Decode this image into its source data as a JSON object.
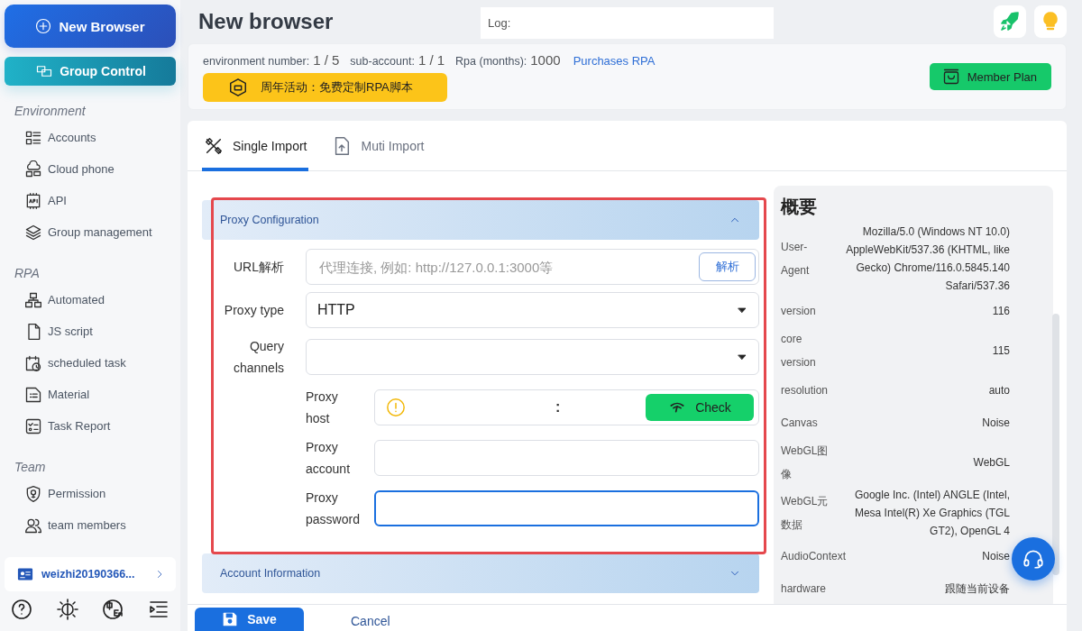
{
  "sidebar": {
    "new_button": "New Browser",
    "group_button": "Group Control",
    "sections": [
      {
        "title": "Environment",
        "items": [
          {
            "label": "Accounts"
          },
          {
            "label": "Cloud phone"
          },
          {
            "label": "API"
          },
          {
            "label": "Group management"
          }
        ]
      },
      {
        "title": "RPA",
        "items": [
          {
            "label": "Automated"
          },
          {
            "label": "JS script"
          },
          {
            "label": "scheduled task"
          },
          {
            "label": "Material"
          },
          {
            "label": "Task Report"
          }
        ]
      },
      {
        "title": "Team",
        "items": [
          {
            "label": "Permission"
          },
          {
            "label": "team members"
          }
        ]
      }
    ],
    "user": "weizhi20190366..."
  },
  "header": {
    "title": "New browser",
    "log_placeholder": "Log:"
  },
  "info": {
    "stats": [
      {
        "label": "environment number:",
        "value": "1 / 5"
      },
      {
        "label": "sub-account:",
        "value": "1 / 1"
      },
      {
        "label": "Rpa (months):",
        "value": "1000"
      }
    ],
    "link": "Purchases RPA",
    "promo": "周年活动：免费定制RPA脚本",
    "member_button": "Member Plan"
  },
  "tabs": [
    {
      "label": "Single Import",
      "selected": true
    },
    {
      "label": "Muti Import",
      "selected": false
    }
  ],
  "proxy": {
    "title": "Proxy Configuration",
    "expanded": true,
    "url": {
      "label": "URL解析",
      "placeholder": "代理连接, 例如: http://127.0.0.1:3000等",
      "button": "解析"
    },
    "type": {
      "label": "Proxy type",
      "value": "HTTP"
    },
    "channels": {
      "label": "Query channels"
    },
    "host": {
      "label": "Proxy host",
      "separator": ":",
      "button": "Check"
    },
    "account": {
      "label": "Proxy account"
    },
    "password": {
      "label": "Proxy password",
      "focused": true
    }
  },
  "account_section": {
    "title": "Account Information",
    "expanded": false
  },
  "summary": {
    "title": "概要",
    "rows": [
      {
        "label": "User-Agent",
        "value": "Mozilla/5.0 (Windows NT 10.0) AppleWebKit/537.36 (KHTML, like Gecko) Chrome/116.0.5845.140 Safari/537.36"
      },
      {
        "label": "version",
        "value": "116"
      },
      {
        "label": "core version",
        "value": "115"
      },
      {
        "label": "resolution",
        "value": "auto"
      },
      {
        "label": "Canvas",
        "value": "Noise"
      },
      {
        "label": "WebGL图像",
        "value": "WebGL"
      },
      {
        "label": "WebGL元数据",
        "value": "Google Inc. (Intel) ANGLE (Intel, Mesa Intel(R) Xe Graphics (TGL GT2), OpenGL 4"
      },
      {
        "label": "AudioContext",
        "value": "Noise"
      },
      {
        "label": "hardware",
        "value": "跟随当前设备"
      }
    ]
  },
  "footer": {
    "save": "Save",
    "cancel": "Cancel"
  }
}
